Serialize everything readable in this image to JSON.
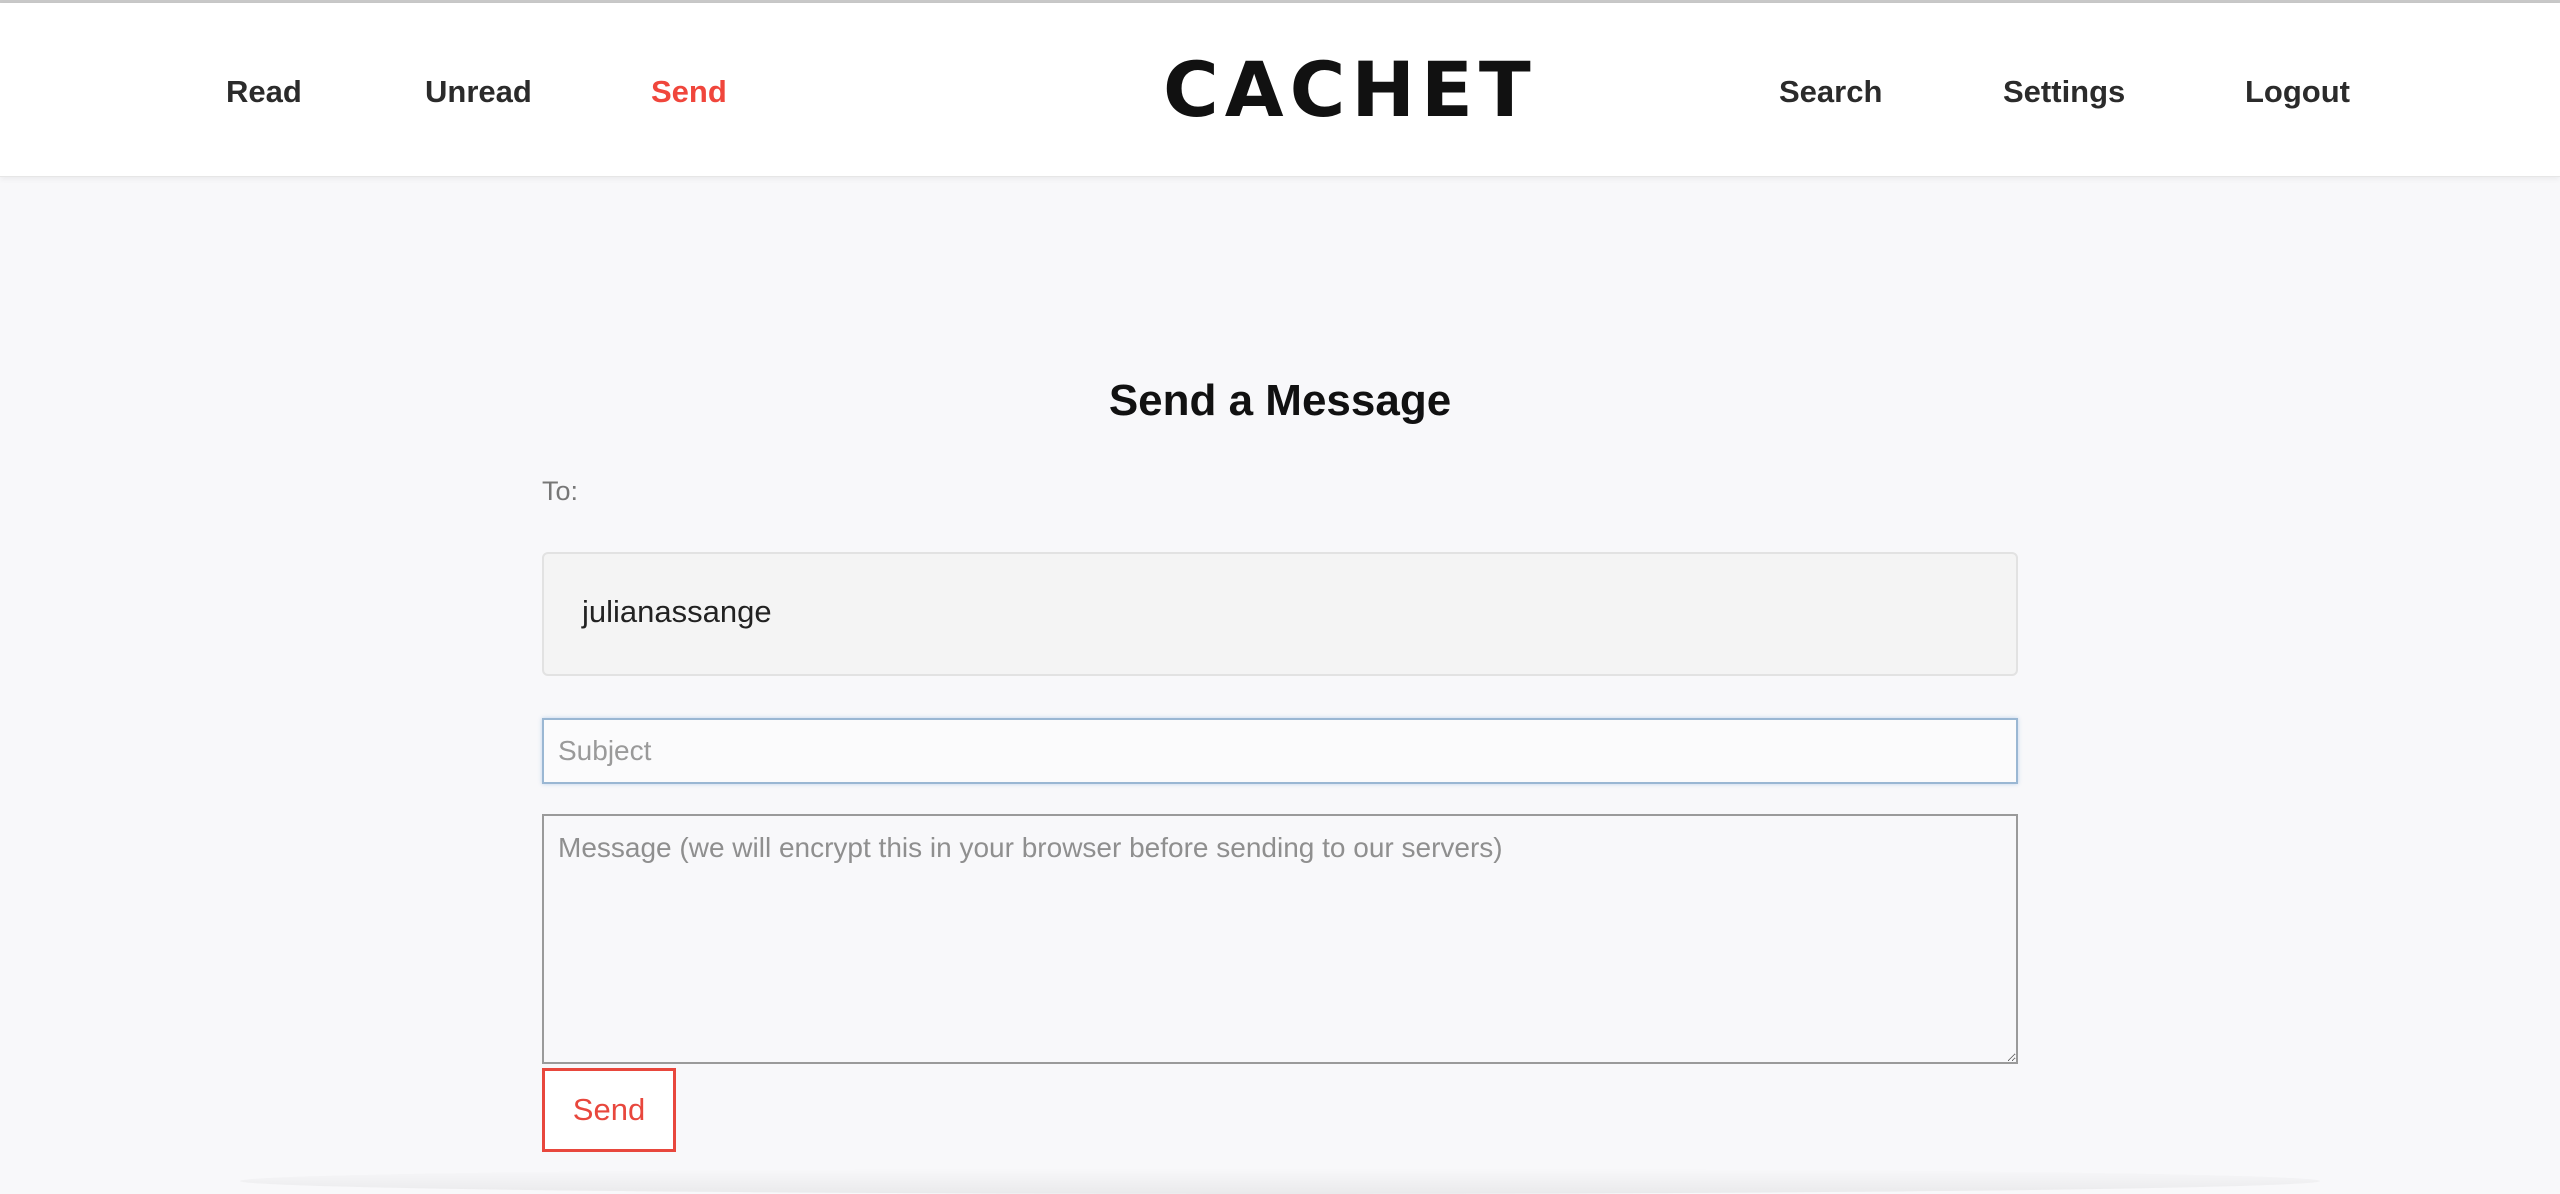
{
  "nav": {
    "left": [
      {
        "label": "Read"
      },
      {
        "label": "Unread"
      },
      {
        "label": "Send",
        "active": true
      }
    ],
    "right": [
      {
        "label": "Search"
      },
      {
        "label": "Settings"
      },
      {
        "label": "Logout"
      }
    ]
  },
  "brand": {
    "logo": "CACHET"
  },
  "form": {
    "title": "Send a Message",
    "to_label": "To:",
    "recipient": "julianassange",
    "subject_placeholder": "Subject",
    "subject_value": "",
    "message_placeholder": "Message (we will encrypt this in your browser before sending to our servers)",
    "message_value": "",
    "send_label": "Send"
  },
  "colors": {
    "accent": "#f0463c",
    "text": "#2b2b2b",
    "background": "#f8f8fa",
    "header": "#ffffff"
  }
}
